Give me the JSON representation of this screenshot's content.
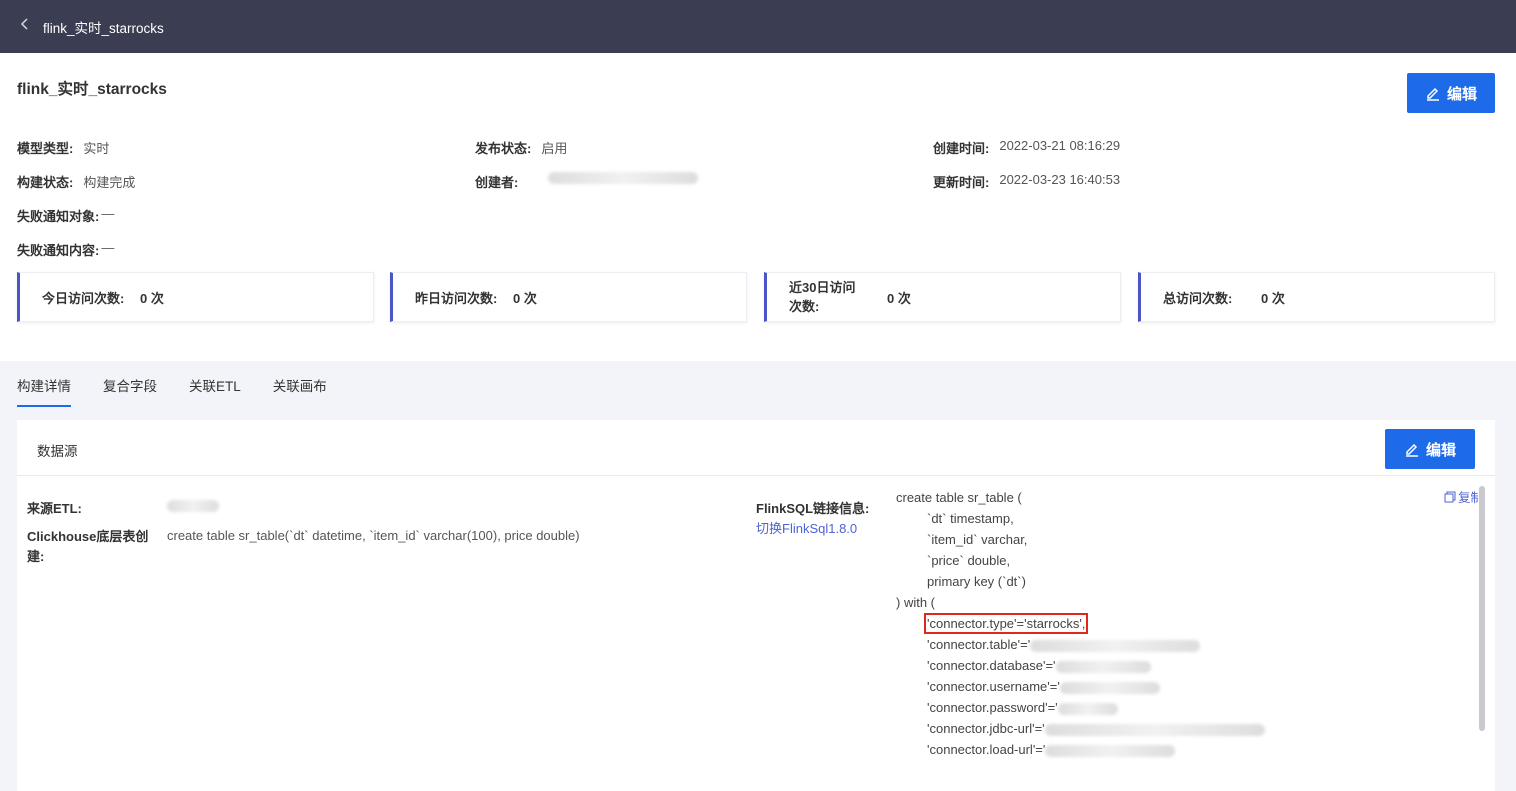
{
  "breadcrumb": {
    "back_icon": "chevron-left-icon",
    "title": "flink_实时_starrocks"
  },
  "header": {
    "title": "flink_实时_starrocks",
    "edit_label": "编辑"
  },
  "info": {
    "model_type_label": "模型类型:",
    "model_type": "实时",
    "publish_status_label": "发布状态:",
    "publish_status": "启用",
    "created_time_label": "创建时间:",
    "created_time": "2022-03-21 08:16:29",
    "build_status_label": "构建状态:",
    "build_status": "构建完成",
    "creator_label": "创建者:",
    "updated_time_label": "更新时间:",
    "updated_time": "2022-03-23 16:40:53",
    "fail_target_label": "失败通知对象:",
    "fail_target": "—",
    "fail_content_label": "失败通知内容:",
    "fail_content": "—"
  },
  "stats": [
    {
      "label": "今日访问次数:",
      "value": "0 次"
    },
    {
      "label": "昨日访问次数:",
      "value": "0 次"
    },
    {
      "label": "近30日访问次数:",
      "value": "0 次"
    },
    {
      "label": "总访问次数:",
      "value": "0 次"
    }
  ],
  "tabs": [
    "构建详情",
    "复合字段",
    "关联ETL",
    "关联画布"
  ],
  "panel": {
    "title": "数据源",
    "edit_label": "编辑",
    "source_etl_label": "来源ETL:",
    "ch_create_label": "Clickhouse底层表创建:",
    "ch_create_sql": "create table sr_table(`dt` datetime, `item_id` varchar(100), price double)",
    "flinksql_label": "FlinkSQL链接信息:",
    "switch_link": "切换FlinkSql1.8.0",
    "copy_label": "复制",
    "code": {
      "l1": "create table sr_table (",
      "l2": "`dt` timestamp,",
      "l3": "`item_id` varchar,",
      "l4": "`price` double,",
      "l5": "primary key (`dt`)",
      "l6": ") with (",
      "l7": "'connector.type'='starrocks',",
      "l8": "'connector.table'='",
      "l9": "'connector.database'='",
      "l10": "'connector.username'='",
      "l11": "'connector.password'='",
      "l12": "'connector.jdbc-url'='",
      "l13": "'connector.load-url'='"
    }
  },
  "colors": {
    "topbar": "#3b3d52",
    "primary": "#1e6bea",
    "accent": "#4a56c8",
    "highlight": "#e0261f"
  }
}
